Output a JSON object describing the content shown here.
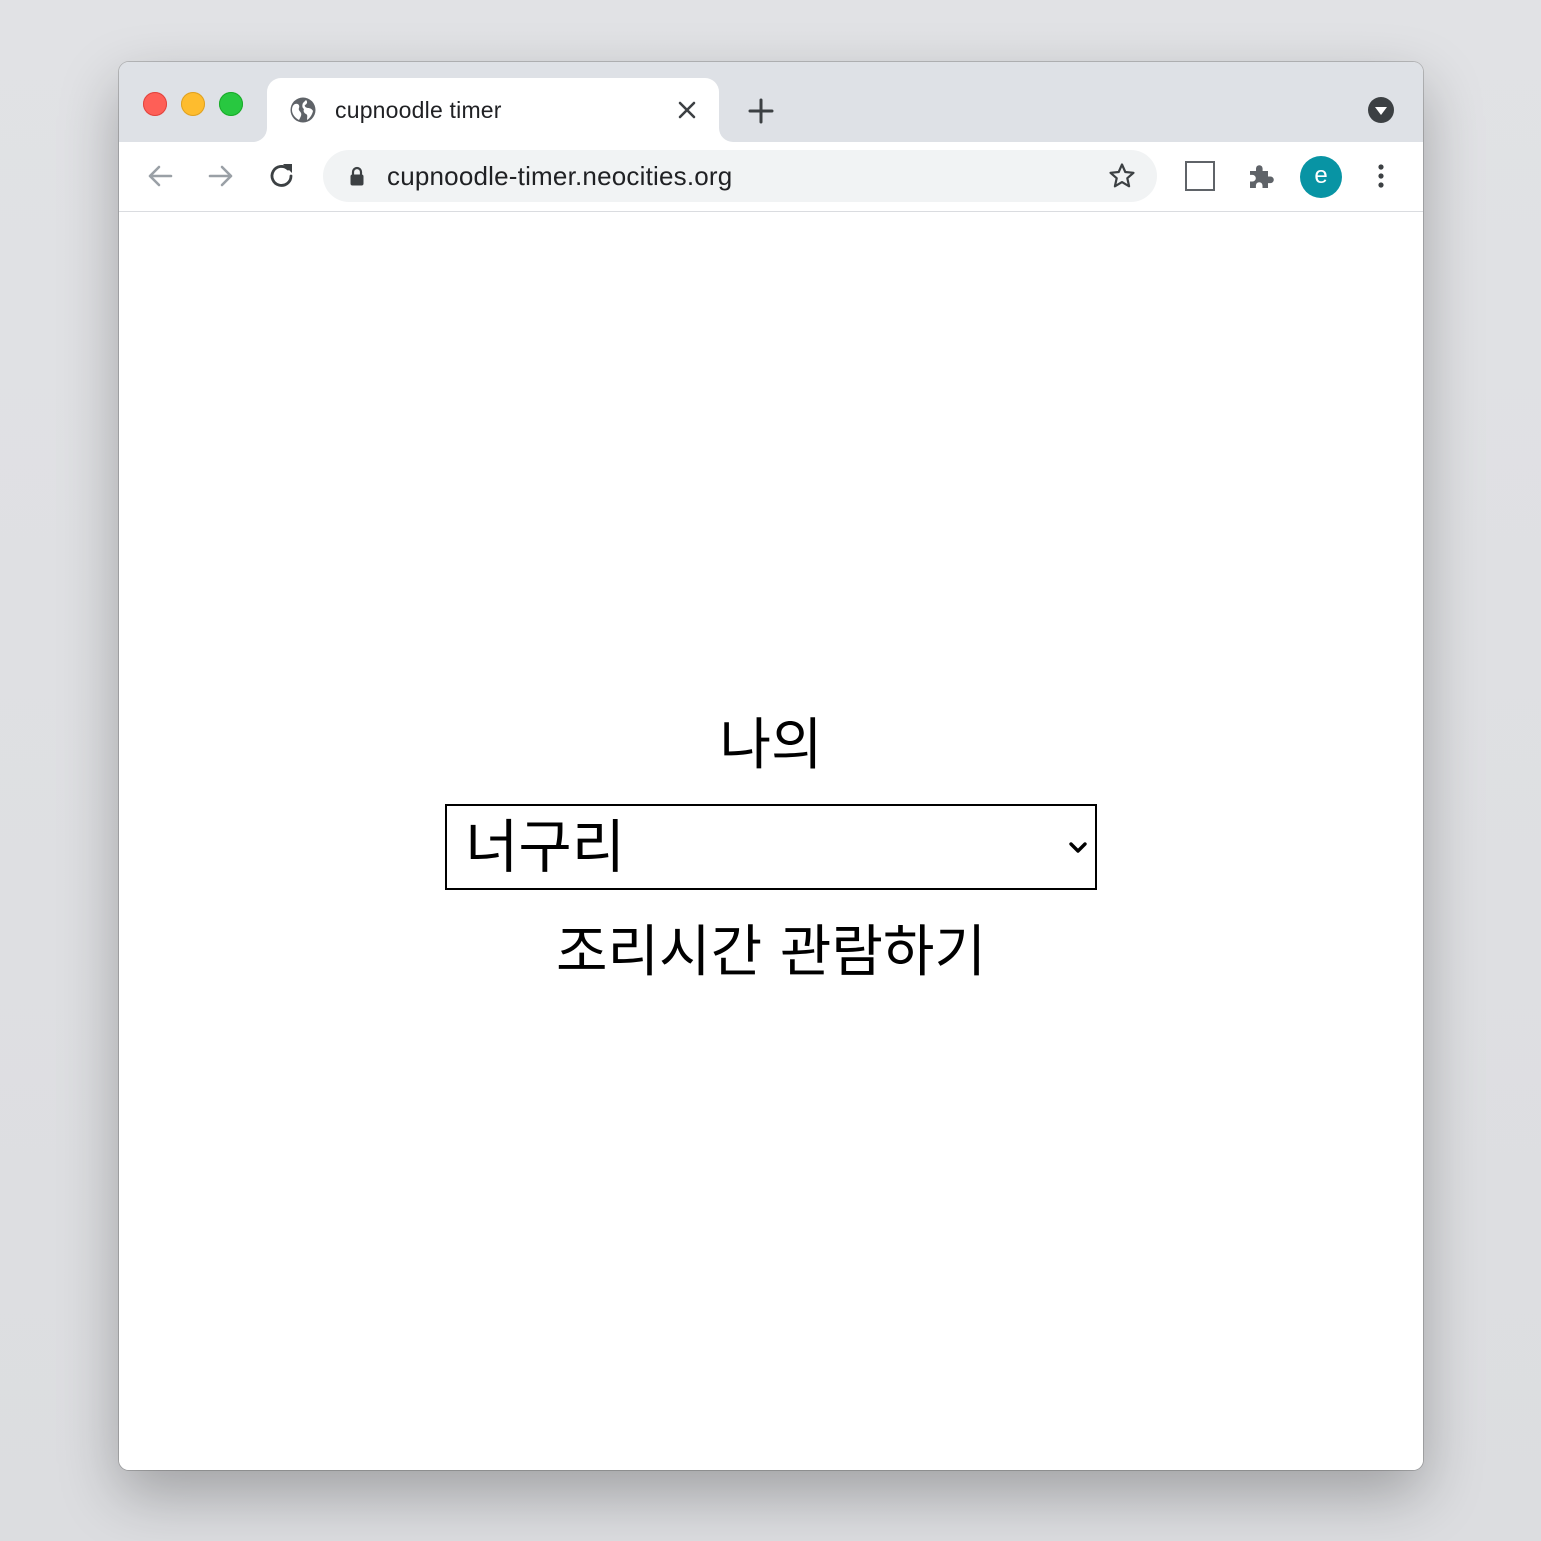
{
  "browser": {
    "tab": {
      "title": "cupnoodle timer",
      "favicon": "globe-icon",
      "close": "close-icon"
    },
    "new_tab": "plus-icon",
    "tab_search": "chevron-down-circle-icon",
    "toolbar": {
      "back": "arrow-left-icon",
      "forward": "arrow-right-icon",
      "reload": "reload-icon",
      "lock": "lock-icon",
      "url": "cupnoodle-timer.neocities.org",
      "bookmark": "star-icon",
      "extension_blank": "square-icon",
      "extensions": "puzzle-icon",
      "profile_initial": "e",
      "menu": "kebab-menu-icon"
    },
    "colors": {
      "avatar": "#0894a4",
      "close_light": "#fe5f57",
      "minimize_light": "#febc2e",
      "maximize_light": "#28c840"
    }
  },
  "page": {
    "label_top": "나의",
    "ramen_select": {
      "selected": "너구리"
    },
    "label_bottom": "조리시간 관람하기"
  }
}
